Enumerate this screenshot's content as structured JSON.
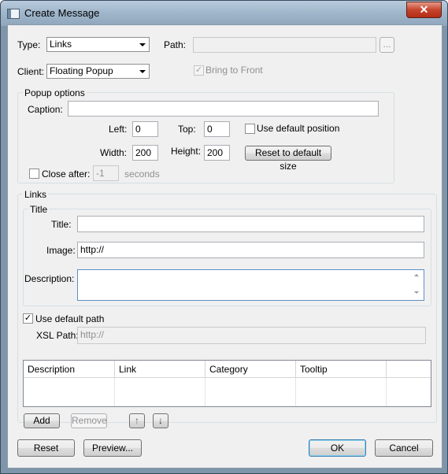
{
  "window": {
    "title": "Create Message",
    "close_glyph": "✕"
  },
  "type": {
    "label": "Type:",
    "value": "Links"
  },
  "path": {
    "label": "Path:",
    "value": "",
    "browse_label": "..."
  },
  "client": {
    "label": "Client:",
    "value": "Floating Popup"
  },
  "bring_to_front": {
    "label": "Bring to Front",
    "checked": true,
    "enabled": false
  },
  "popup_options": {
    "legend": "Popup options",
    "caption_label": "Caption:",
    "caption_value": "",
    "left_label": "Left:",
    "left_value": "0",
    "top_label": "Top:",
    "top_value": "0",
    "use_default_position_label": "Use default position",
    "width_label": "Width:",
    "width_value": "200",
    "height_label": "Height:",
    "height_value": "200",
    "reset_size_label": "Reset to default size",
    "close_after_label": "Close after:",
    "close_after_value": "-1",
    "seconds_label": "seconds"
  },
  "links": {
    "legend": "Links",
    "title_group": {
      "legend": "Title",
      "title_label": "Title:",
      "title_value": "",
      "image_label": "Image:",
      "image_value": "http://",
      "description_label": "Description:",
      "description_value": ""
    },
    "use_default_path_label": "Use default path",
    "use_default_path_checked": true,
    "xsl_path_label": "XSL Path:",
    "xsl_path_value": "http://",
    "columns": [
      "Description",
      "Link",
      "Category",
      "Tooltip"
    ],
    "add_label": "Add",
    "remove_label": "Remove",
    "move_up_glyph": "↑",
    "move_down_glyph": "↓"
  },
  "footer": {
    "reset_label": "Reset",
    "preview_label": "Preview...",
    "ok_label": "OK",
    "cancel_label": "Cancel"
  },
  "check_glyph": "✓"
}
